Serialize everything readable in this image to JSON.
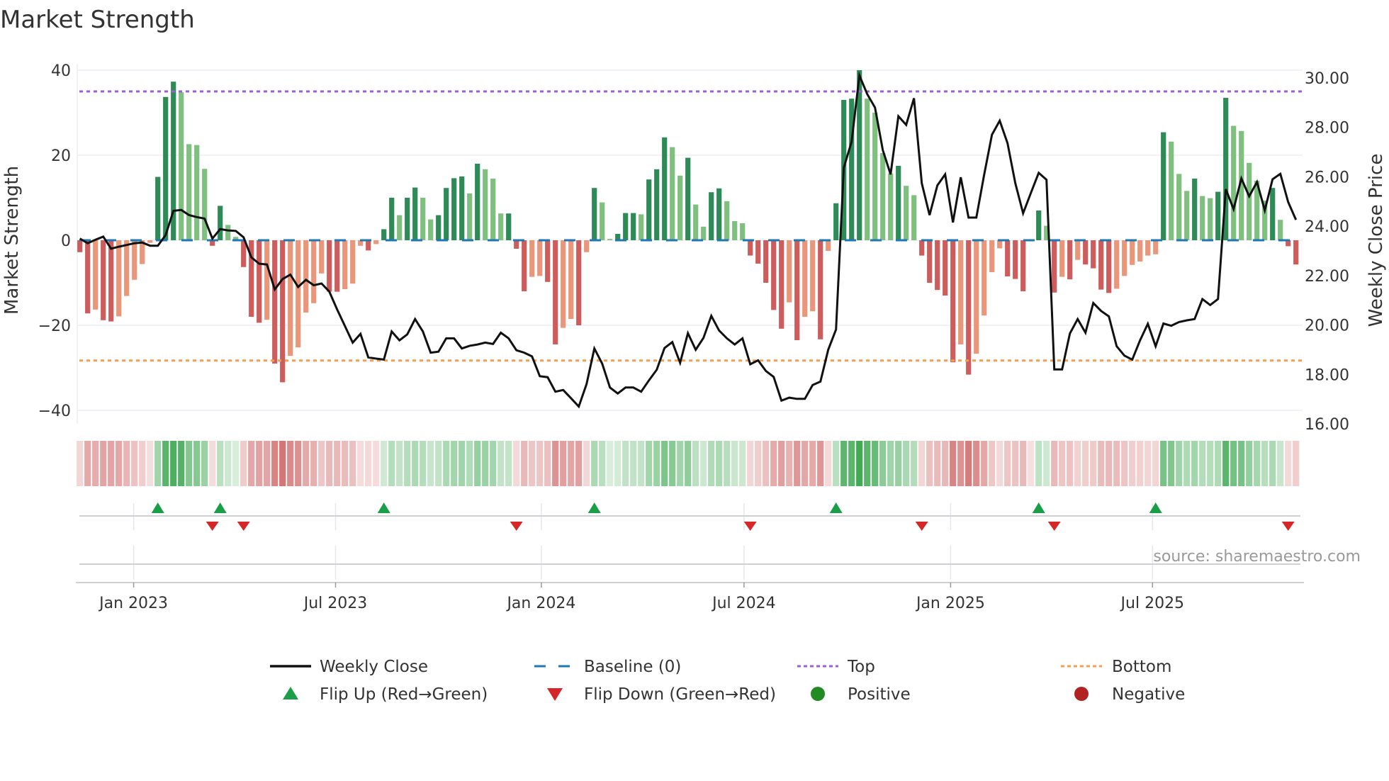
{
  "chart_data": {
    "type": "bar",
    "title": "Market Strength",
    "ylabel": "Market Strength",
    "y2label": "Weekly Close Price",
    "ylim": [
      -42,
      42
    ],
    "y2lim": [
      16,
      30
    ],
    "yticks": [
      {
        "v": 40,
        "label": "40"
      },
      {
        "v": 20,
        "label": "20"
      },
      {
        "v": 0,
        "label": "0"
      },
      {
        "v": -20,
        "label": "−20"
      },
      {
        "v": -40,
        "label": "−40"
      }
    ],
    "y2ticks": [
      {
        "v": 30,
        "label": "30.00"
      },
      {
        "v": 28,
        "label": "28.00"
      },
      {
        "v": 26,
        "label": "26.00"
      },
      {
        "v": 24,
        "label": "24.00"
      },
      {
        "v": 22,
        "label": "22.00"
      },
      {
        "v": 20,
        "label": "20.00"
      },
      {
        "v": 18,
        "label": "18.00"
      },
      {
        "v": 16,
        "label": "16.00"
      }
    ],
    "x_unit": "week index (weekly)",
    "xticks": [
      {
        "week": 6.9,
        "label": "Jan 2023"
      },
      {
        "week": 32.8,
        "label": "Jul 2023"
      },
      {
        "week": 59.2,
        "label": "Jan 2024"
      },
      {
        "week": 85.2,
        "label": "Jul 2024"
      },
      {
        "week": 111.7,
        "label": "Jan 2025"
      },
      {
        "week": 137.6,
        "label": "Jul 2025"
      }
    ],
    "top_level": 35,
    "bottom_level": -28.3,
    "baseline": 0,
    "strength": [
      -2.8,
      -17.2,
      -16.3,
      -18.8,
      -19.1,
      -17.9,
      -13.1,
      -9.3,
      -5.6,
      -0.6,
      14.9,
      33.7,
      37.3,
      34.8,
      22.6,
      22.4,
      16.8,
      -1.3,
      8.1,
      3.6,
      0.8,
      -6.3,
      -18,
      -19.4,
      -18.7,
      -29,
      -33.4,
      -27.2,
      -25.2,
      -17,
      -14.8,
      -7.8,
      -12.1,
      -12.1,
      -11.5,
      -10.2,
      -1.3,
      -2.4,
      -0.9,
      2.6,
      10,
      5.9,
      10,
      12.4,
      10,
      4.9,
      5.9,
      12.3,
      14.6,
      15,
      11,
      18,
      16.7,
      14.5,
      6.3,
      6.3,
      -2,
      -12,
      -8.6,
      -8.4,
      -9.8,
      -24.5,
      -20.6,
      -18.5,
      -20,
      -2.8,
      12.3,
      8.9,
      0.3,
      1.5,
      6.4,
      6.4,
      6.1,
      14.3,
      16.7,
      24.2,
      21.9,
      15.2,
      19.4,
      8.4,
      3.2,
      11.3,
      12.2,
      9.2,
      4.5,
      4,
      -3.6,
      -5.5,
      -10,
      -16.4,
      -20.8,
      -14.6,
      -23.5,
      -18,
      -16.7,
      -23.3,
      -2.5,
      8.7,
      33,
      33.3,
      40,
      33.3,
      30,
      20.5,
      15.7,
      17.5,
      12.8,
      10.6,
      -3.6,
      -10,
      -11.7,
      -13,
      -28.7,
      -24.5,
      -31.6,
      -26.7,
      -17.7,
      -7.5,
      -1.9,
      -8.5,
      -9.1,
      -12,
      0,
      7,
      3.4,
      -12.3,
      -8.6,
      -9.2,
      -4.6,
      -5.7,
      -6.6,
      -11.6,
      -12.4,
      -11.4,
      -8.4,
      -5.8,
      -5,
      -3.6,
      -3.3,
      25.4,
      23.2,
      15.6,
      11.6,
      14.5,
      10.4,
      9.9,
      11.4,
      33.5,
      26.9,
      25.7,
      18.2,
      14,
      9.3,
      12.3,
      4.8,
      -1.4,
      -5.7
    ],
    "weekly_close": [
      23.5,
      23.31,
      23.45,
      23.58,
      23.09,
      23.17,
      23.24,
      23.31,
      23.34,
      23.21,
      23.21,
      23.64,
      24.62,
      24.66,
      24.45,
      24.37,
      24.31,
      23.5,
      23.88,
      23.83,
      23.81,
      23.55,
      22.74,
      22.48,
      22.45,
      21.44,
      21.86,
      22.04,
      21.54,
      21.83,
      21.61,
      21.68,
      21.35,
      20.63,
      19.96,
      19.29,
      19.64,
      18.69,
      18.64,
      18.6,
      19.74,
      19.38,
      19.62,
      20.24,
      19.74,
      18.88,
      18.92,
      19.46,
      19.46,
      19.05,
      19.16,
      19.21,
      19.29,
      19.23,
      19.69,
      19.46,
      18.98,
      18.88,
      18.73,
      17.93,
      17.89,
      17.3,
      17.37,
      17.04,
      16.7,
      17.61,
      19.05,
      18.44,
      17.47,
      17.23,
      17.47,
      17.47,
      17.3,
      17.76,
      18.19,
      19.07,
      19.31,
      18.47,
      19.67,
      19.0,
      19.48,
      20.37,
      19.78,
      19.46,
      19.21,
      19.46,
      18.41,
      18.57,
      18.14,
      17.9,
      16.94,
      17.06,
      17.01,
      17.01,
      17.57,
      17.71,
      19.0,
      19.82,
      26.37,
      27.42,
      30.1,
      29.35,
      28.8,
      27.08,
      26.1,
      28.45,
      28.1,
      29.18,
      25.74,
      24.45,
      25.65,
      26.1,
      24.15,
      25.98,
      24.35,
      24.35,
      26.08,
      27.7,
      28.27,
      27.36,
      25.74,
      24.52,
      25.35,
      26.16,
      25.88,
      18.2,
      18.2,
      19.66,
      20.24,
      19.69,
      20.89,
      20.57,
      20.35,
      19.14,
      18.76,
      18.6,
      19.38,
      20.05,
      19.14,
      20.06,
      19.97,
      20.12,
      20.19,
      20.24,
      21.05,
      20.81,
      21.05,
      25.5,
      24.69,
      25.93,
      25.21,
      25.79,
      24.64,
      25.9,
      26.12,
      24.98,
      24.26
    ],
    "flip_up_weeks": [
      10,
      18,
      39,
      66,
      97,
      123,
      138
    ],
    "flip_down_weeks": [
      17,
      21,
      56,
      86,
      108,
      125,
      155
    ],
    "legend": [
      {
        "key": "weekly_close",
        "label": "Weekly Close",
        "symbol": "line"
      },
      {
        "key": "baseline",
        "label": "Baseline (0)",
        "symbol": "dash"
      },
      {
        "key": "top",
        "label": "Top",
        "symbol": "dot-purple"
      },
      {
        "key": "bottom",
        "label": "Bottom",
        "symbol": "dot-orange"
      },
      {
        "key": "flip_up",
        "label": "Flip Up (Red→Green)",
        "symbol": "tri-up"
      },
      {
        "key": "flip_down",
        "label": "Flip Down (Green→Red)",
        "symbol": "tri-down"
      },
      {
        "key": "positive",
        "label": "Positive",
        "symbol": "dot-green"
      },
      {
        "key": "negative",
        "label": "Negative",
        "symbol": "dot-red"
      }
    ],
    "legend_position": "bottom",
    "grid": true
  },
  "source_text": "source: sharemaestro.com",
  "colors": {
    "pos_strong": "#2e8b57",
    "pos_weak": "#7fbf7f",
    "neg_strong": "#cd5c5c",
    "neg_weak": "#e9967a",
    "close": "#111111",
    "baseline": "#1f77b4",
    "top": "#9b5fd6",
    "bottom": "#f0a050",
    "flip_up": "#1a9e48",
    "flip_down": "#d62728",
    "positive": "#228b22",
    "negative": "#b22222",
    "heat_pos": "46,160,67",
    "heat_neg": "200,80,80"
  }
}
